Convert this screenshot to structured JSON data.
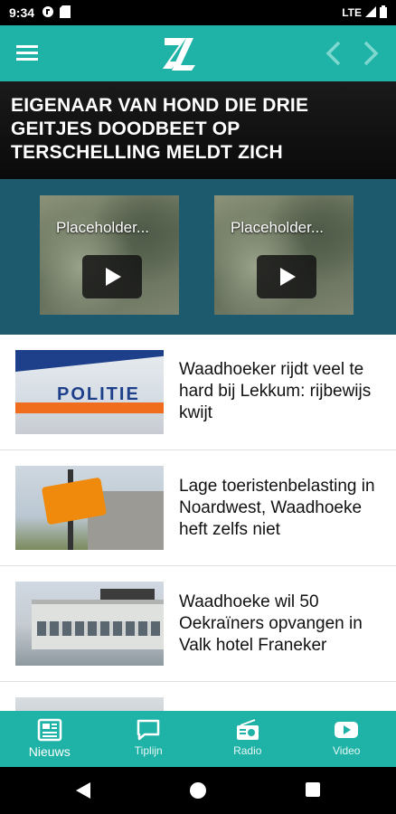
{
  "status_bar": {
    "time": "9:34",
    "network": "LTE"
  },
  "app_bar": {
    "logo_text": "Z"
  },
  "headline": "EIGENAAR VAN HOND DIE DRIE GEITJES DOODBEET OP TERSCHELLING MELDT ZICH",
  "videos": [
    {
      "title": "Placeholder..."
    },
    {
      "title": "Placeholder..."
    }
  ],
  "articles": [
    {
      "title": "Waadhoeker rijdt veel te hard bij Lekkum: rijbewijs kwijt",
      "image_text": "POLITIE"
    },
    {
      "title": "Lage toeristenbelasting in Noardwest, Waadhoeke heft zelfs niet"
    },
    {
      "title": "Waadhoeke wil 50 Oekraïners opvangen in Valk hotel Franeker"
    }
  ],
  "bottom_nav": {
    "tabs": [
      {
        "label": "Nieuws",
        "icon": "newspaper-icon"
      },
      {
        "label": "Tiplijn",
        "icon": "chat-icon"
      },
      {
        "label": "Radio",
        "icon": "radio-icon"
      },
      {
        "label": "Video",
        "icon": "video-play-icon"
      }
    ]
  }
}
